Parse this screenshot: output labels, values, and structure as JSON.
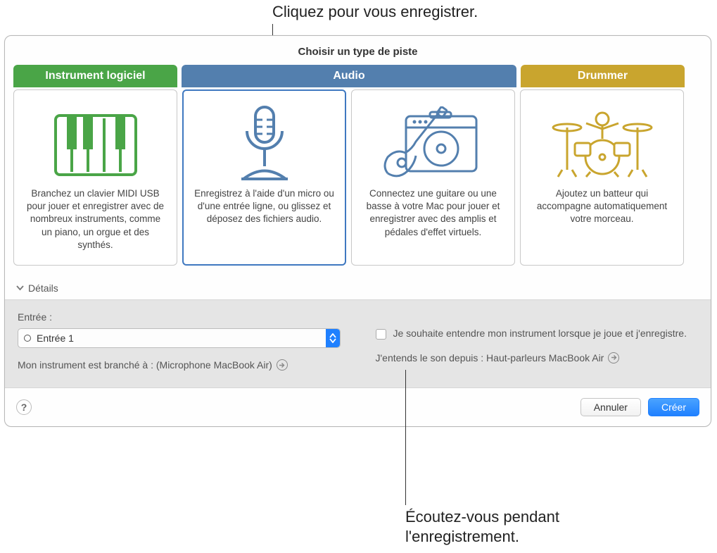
{
  "callouts": {
    "top": "Cliquez pour vous enregistrer.",
    "bottom": "Écoutez-vous pendant\nl'enregistrement."
  },
  "dialog": {
    "title": "Choisir un type de piste",
    "tabs": {
      "software": "Instrument logiciel",
      "audio": "Audio",
      "drummer": "Drummer"
    },
    "cards": {
      "software": "Branchez un clavier MIDI USB pour jouer et enregistrer avec de nombreux instruments, comme un piano, un orgue et des synthés.",
      "mic": "Enregistrez à l'aide d'un micro ou d'une entrée ligne, ou glissez et déposez des fichiers audio.",
      "guitar": "Connectez une guitare ou une basse à votre Mac pour jouer et enregistrer avec des amplis et pédales d'effet virtuels.",
      "drummer": "Ajoutez un batteur qui accompagne automatiquement votre morceau."
    },
    "details_label": "Détails",
    "input_label": "Entrée :",
    "input_value": "Entrée 1",
    "connected_label": "Mon instrument est branché à : (Microphone MacBook Air)",
    "monitor_label": "Je souhaite entendre mon instrument lorsque je joue et j'enregistre.",
    "output_label": "J'entends le son depuis : Haut-parleurs MacBook Air",
    "cancel": "Annuler",
    "create": "Créer"
  },
  "icons": {
    "keyboard": "keyboard-icon",
    "mic": "microphone-icon",
    "guitar": "guitar-amp-icon",
    "drums": "drumkit-icon"
  },
  "colors": {
    "software_tab": "#4aa547",
    "audio_tab": "#537fae",
    "drummer_tab": "#c9a52e",
    "selection": "#3f78c0",
    "primary_button": "#1f80ff"
  }
}
